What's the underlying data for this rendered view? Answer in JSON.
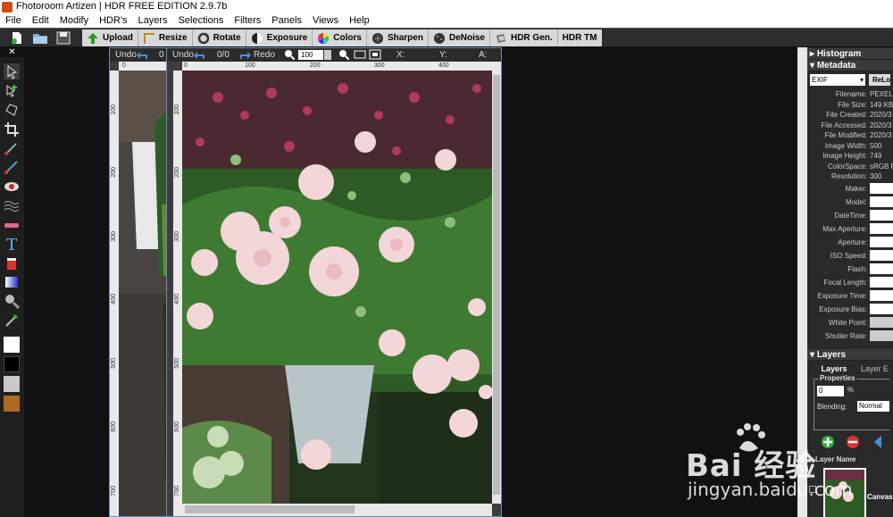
{
  "window": {
    "title": "Fhotoroom Artizen | HDR FREE EDITION 2.9.7b"
  },
  "menu": [
    "File",
    "Edit",
    "Modify",
    "HDR's",
    "Layers",
    "Selections",
    "Filters",
    "Panels",
    "Views",
    "Help"
  ],
  "toolbar": {
    "buttons": [
      "Upload",
      "Resize",
      "Rotate",
      "Exposure",
      "Colors",
      "Sharpen",
      "DeNoise",
      "HDR Gen.",
      "HDR TM"
    ]
  },
  "left_close": "✕",
  "doc_back": {
    "undo": "Undo",
    "count": "0",
    "ruler_top": [
      "0"
    ]
  },
  "doc_front": {
    "undo": "Undo",
    "undo_count": "0/0",
    "redo": "Redo",
    "zoom": "100",
    "x_label": "X:",
    "y_label": "Y:",
    "a_label": "A:",
    "ruler_top": [
      "0",
      "100",
      "200",
      "300",
      "400"
    ],
    "ruler_left": [
      "100",
      "200",
      "300",
      "400",
      "500",
      "600",
      "700"
    ]
  },
  "doc_back_ruler_left": [
    "100",
    "200",
    "300",
    "400",
    "500",
    "600",
    "700"
  ],
  "panels": {
    "histogram": "Histogram",
    "metadata": "Metadata",
    "exif_select": "EXIF",
    "reload": "ReLo",
    "meta_rows": [
      {
        "k": "Filename:",
        "v": "PEXELS"
      },
      {
        "k": "File Size:",
        "v": "149 KB"
      },
      {
        "k": "File Created:",
        "v": "2020/3"
      },
      {
        "k": "File Accessed:",
        "v": "2020/3"
      },
      {
        "k": "File Modified:",
        "v": "2020/3"
      },
      {
        "k": "Image Width:",
        "v": "500"
      },
      {
        "k": "Image Height:",
        "v": "749"
      },
      {
        "k": "ColorSpace:",
        "v": "sRGB P"
      },
      {
        "k": "Resolution:",
        "v": "300"
      }
    ],
    "meta_fields": [
      "Maker:",
      "Model:",
      "DateTime:",
      "Max Aperture:",
      "Aperture:",
      "ISO Speed:",
      "Flash:",
      "Focal Length:",
      "Exposure Time:",
      "Exposure Bias:",
      "White Point:",
      "Shutter Rate:"
    ],
    "layers": "Layers",
    "layer_tabs": [
      "Layers",
      "Layer E"
    ],
    "properties": "Properties",
    "opacity_value": "0",
    "opacity_unit": "%",
    "blending_label": "Blending:",
    "blending_value": "Normal",
    "layer_name_header": "Layer Name",
    "layer_name": "Canvas"
  },
  "watermark": {
    "line1": "Bai 经验",
    "line2": "jingyan.baidu.com"
  }
}
